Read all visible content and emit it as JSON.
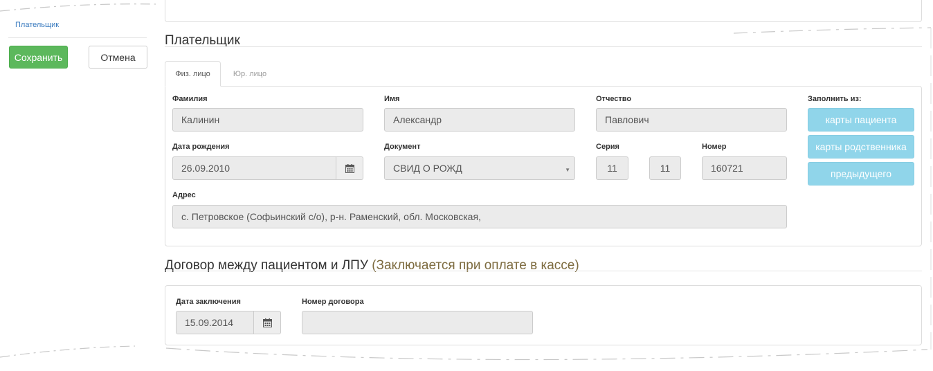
{
  "sidebar": {
    "link": "Плательщик",
    "save_label": "Сохранить",
    "cancel_label": "Отмена"
  },
  "payer": {
    "title": "Плательщик",
    "tabs": [
      {
        "label": "Физ. лицо",
        "active": true
      },
      {
        "label": "Юр. лицо",
        "active": false
      }
    ],
    "fields": {
      "last_name": {
        "label": "Фамилия",
        "value": "Калинин"
      },
      "first_name": {
        "label": "Имя",
        "value": "Александр"
      },
      "patronymic": {
        "label": "Отчество",
        "value": "Павлович"
      },
      "birth_date": {
        "label": "Дата рождения",
        "value": "26.09.2010"
      },
      "document": {
        "label": "Документ",
        "value": "СВИД О РОЖД"
      },
      "series": {
        "label": "Серия",
        "value1": "11",
        "value2": "11"
      },
      "number": {
        "label": "Номер",
        "value": "160721"
      },
      "address": {
        "label": "Адрес",
        "value": "с. Петровское (Софьинский с/о), р-н. Раменский, обл. Московская,"
      }
    },
    "fill_from": {
      "label": "Заполнить из:",
      "buttons": [
        "карты пациента",
        "карты родственника",
        "предыдущего"
      ]
    }
  },
  "contract": {
    "title": "Договор между пациентом и ЛПУ",
    "note": "(Заключается при оплате в кассе)",
    "date": {
      "label": "Дата заключения",
      "value": "15.09.2014"
    },
    "number": {
      "label": "Номер договора",
      "value": ""
    }
  },
  "icons": [
    "calendar-icon",
    "select-caret-icon"
  ],
  "colors": {
    "save": "#5cb85c",
    "fill_buttons": "#90d5ea",
    "link": "#3a7bbf",
    "note": "#7d6b3f"
  }
}
